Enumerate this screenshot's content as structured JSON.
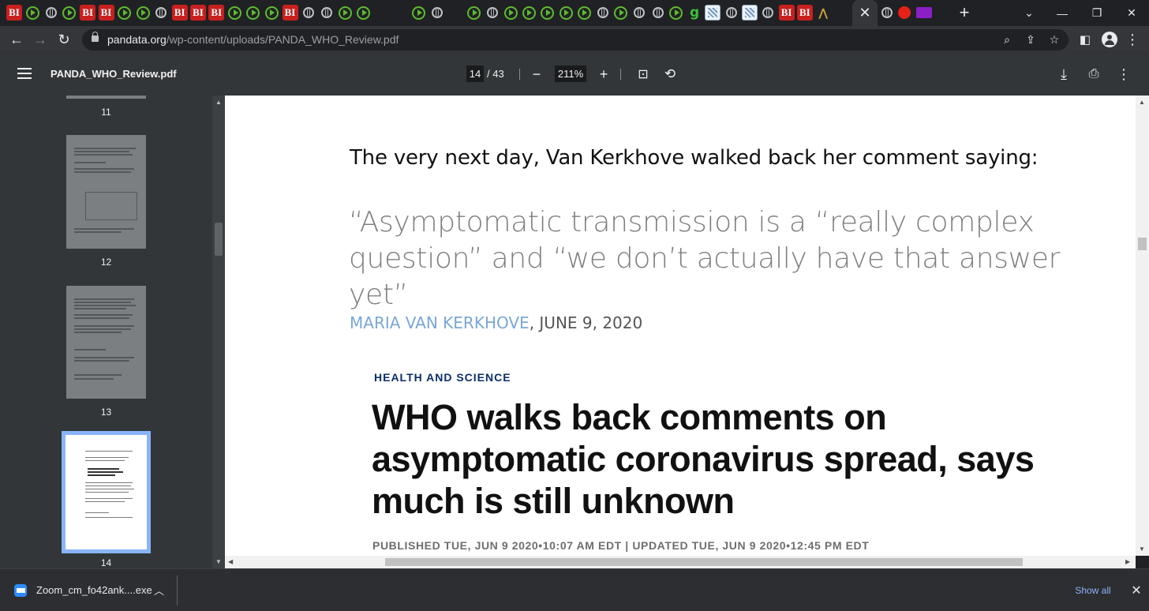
{
  "browser": {
    "active_tab_close": "✕",
    "new_tab": "+",
    "window_controls": {
      "tab_search": "⌄",
      "minimize": "—",
      "maximize": "❐",
      "close": "✕"
    },
    "favicons": [
      "bi",
      "play",
      "globe",
      "play",
      "bi",
      "bi",
      "play",
      "play",
      "globe",
      "bi",
      "bi",
      "bi",
      "play",
      "play",
      "play",
      "bi",
      "globe",
      "globe",
      "play",
      "play",
      "substack",
      "forward",
      "play",
      "globe",
      "forward",
      "play",
      "globe",
      "play",
      "play",
      "play",
      "play",
      "play",
      "globe",
      "play",
      "globe",
      "globe",
      "play",
      "g",
      "tile",
      "globe",
      "tile",
      "globe",
      "bi",
      "bi",
      "road"
    ],
    "after_active_favicons": [
      "globe",
      "shield",
      "mail",
      "substack"
    ],
    "bi_text": "BI",
    "g_text": "g",
    "road_text": "⋀",
    "url_domain": "pandata.org",
    "url_path": "/wp-content/uploads/PANDA_WHO_Review.pdf"
  },
  "pdf_toolbar": {
    "title": "PANDA_WHO_Review.pdf",
    "current_page": "14",
    "page_separator": "/ 43",
    "zoom": "211%",
    "zoom_out": "−",
    "zoom_in": "+"
  },
  "sidebar": {
    "thumbnails": [
      {
        "number": "11"
      },
      {
        "number": "12"
      },
      {
        "number": "13"
      },
      {
        "number": "14",
        "active": true
      }
    ]
  },
  "document": {
    "intro": "The very next day, Van Kerkhove walked back her comment saying:",
    "quote": "“Asymptomatic transmission is a “really complex question” and “we don’t actually have that answer yet”",
    "attribution_name": "MARIA VAN KERKHOVE",
    "attribution_date": ", JUNE 9, 2020",
    "kicker": "HEALTH AND SCIENCE",
    "headline": "WHO walks back comments on asymptomatic coronavirus spread, says much is still unknown",
    "dateline": "PUBLISHED TUE, JUN 9 2020•10:07 AM EDT | UPDATED TUE, JUN 9 2020•12:45 PM EDT"
  },
  "downloads": {
    "file_name": "Zoom_cm_fo42ank....exe",
    "show_all": "Show all",
    "close": "✕"
  },
  "colors": {
    "chrome_dark": "#202124",
    "pdf_toolbar": "#323639",
    "bi_red": "#c8201f",
    "play_green": "#5dbb2f",
    "link_blue": "#8ab4f8",
    "kicker_navy": "#0c2e6a",
    "attribution_blue": "#7ba7d7"
  }
}
